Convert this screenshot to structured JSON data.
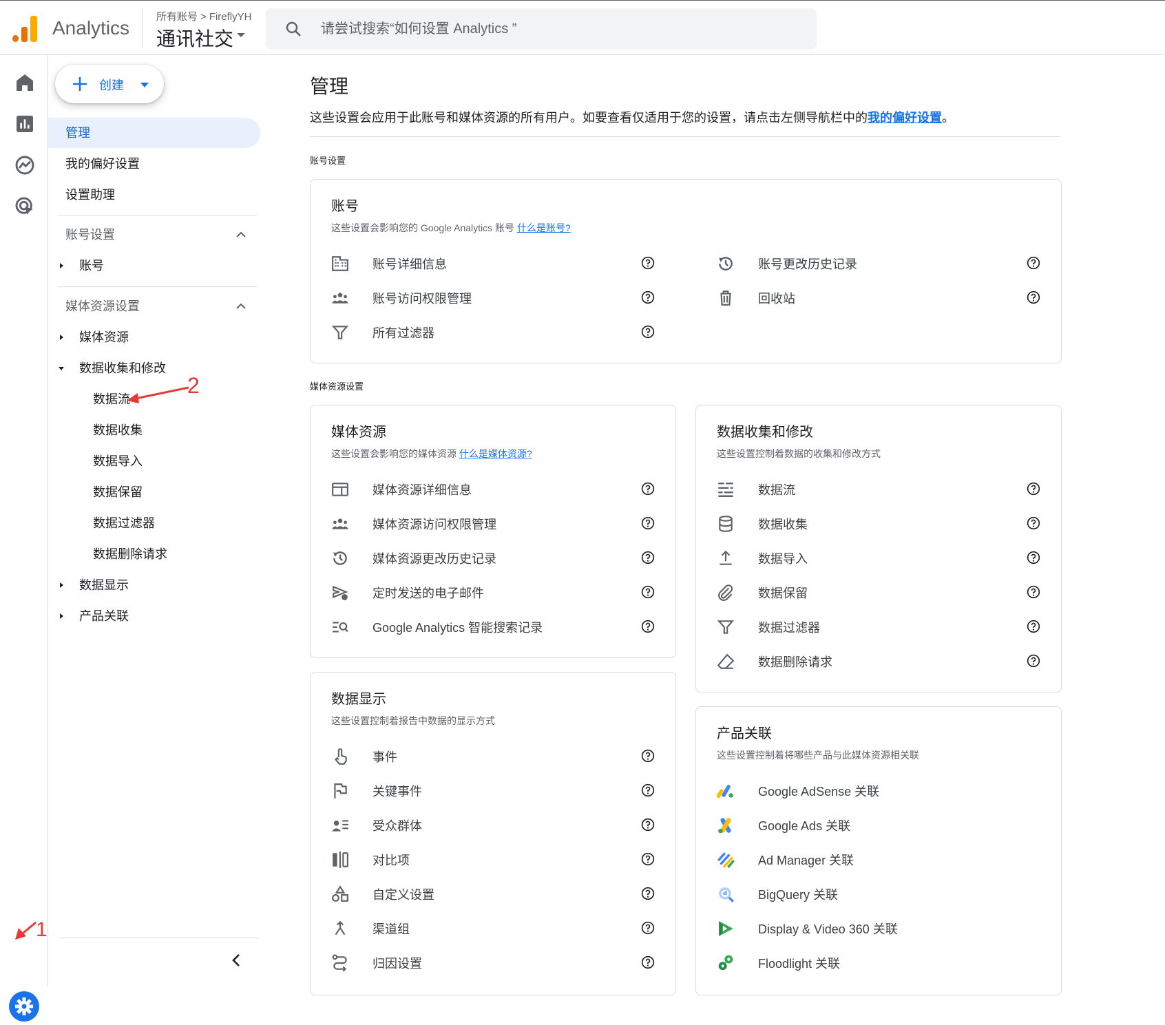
{
  "app": {
    "name": "Analytics"
  },
  "breadcrumb": {
    "root": "所有账号",
    "sep": ">",
    "account": "FireflyYH",
    "property": "通讯社交"
  },
  "search": {
    "placeholder": "请尝试搜索“如何设置 Analytics ”"
  },
  "create": {
    "label": "创建"
  },
  "nav": {
    "admin": "管理",
    "prefs": "我的偏好设置",
    "assistant": "设置助理",
    "account_settings": "账号设置",
    "account": "账号",
    "property_settings": "媒体资源设置",
    "property": "媒体资源",
    "data_collection": "数据收集和修改",
    "sub": [
      "数据流",
      "数据收集",
      "数据导入",
      "数据保留",
      "数据过滤器",
      "数据删除请求"
    ],
    "data_display": "数据显示",
    "product_links": "产品关联"
  },
  "page": {
    "title": "管理",
    "desc": "这些设置会应用于此账号和媒体资源的所有用户。如要查看仅适用于您的设置，请点击左侧导航栏中的",
    "desc_link": "我的偏好设置",
    "desc_end": "。",
    "section_account": "账号设置",
    "section_property": "媒体资源设置"
  },
  "cards": {
    "account": {
      "title": "账号",
      "sub": "这些设置会影响您的 Google Analytics 账号 ",
      "sub_link": "什么是账号?",
      "left": [
        "账号详细信息",
        "账号访问权限管理",
        "所有过滤器"
      ],
      "right": [
        "账号更改历史记录",
        "回收站"
      ]
    },
    "property": {
      "title": "媒体资源",
      "sub": "这些设置会影响您的媒体资源 ",
      "sub_link": "什么是媒体资源?",
      "items": [
        "媒体资源详细信息",
        "媒体资源访问权限管理",
        "媒体资源更改历史记录",
        "定时发送的电子邮件",
        "Google Analytics 智能搜索记录"
      ]
    },
    "data_collection": {
      "title": "数据收集和修改",
      "sub": "这些设置控制着数据的收集和修改方式",
      "items": [
        "数据流",
        "数据收集",
        "数据导入",
        "数据保留",
        "数据过滤器",
        "数据删除请求"
      ]
    },
    "data_display": {
      "title": "数据显示",
      "sub": "这些设置控制着报告中数据的显示方式",
      "items": [
        "事件",
        "关键事件",
        "受众群体",
        "对比项",
        "自定义设置",
        "渠道组",
        "归因设置"
      ]
    },
    "product_links": {
      "title": "产品关联",
      "sub": "这些设置控制着将哪些产品与此媒体资源相关联",
      "items": [
        "Google AdSense 关联",
        "Google Ads 关联",
        "Ad Manager 关联",
        "BigQuery 关联",
        "Display & Video 360 关联",
        "Floodlight 关联"
      ]
    }
  },
  "annotations": {
    "one": "1",
    "two": "2"
  },
  "colors": {
    "accent": "#1a73e8",
    "annotation": "#e53935",
    "active_bg": "#e8f0fe",
    "logo_orange": "#f9ab00",
    "logo_dark": "#e37400"
  },
  "icons": [
    "home-icon",
    "reports-icon",
    "explore-icon",
    "advertising-icon",
    "admin-gear-icon",
    "search-icon",
    "help-icon"
  ]
}
